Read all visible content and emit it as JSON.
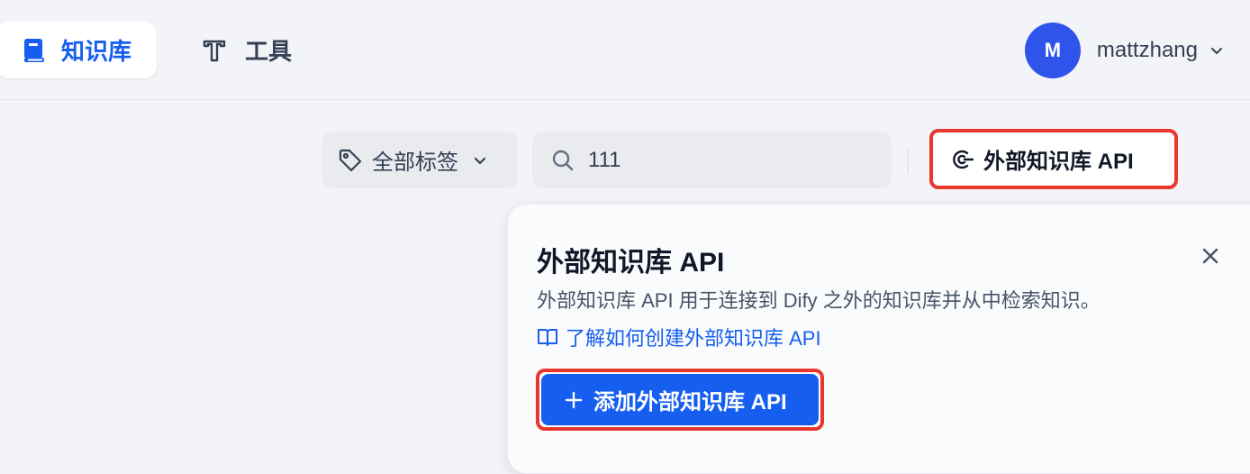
{
  "nav": {
    "tabs": [
      {
        "label": "知识库",
        "icon": "book-icon",
        "active": true
      },
      {
        "label": "工具",
        "icon": "tools-icon",
        "active": false
      }
    ]
  },
  "user": {
    "initial": "M",
    "name": "mattzhang",
    "avatar_color": "#2f54eb"
  },
  "filters": {
    "tag_label": "全部标签",
    "search_value": "111"
  },
  "external_api_button": {
    "label": "外部知识库 API"
  },
  "panel": {
    "title": "外部知识库 API",
    "description": "外部知识库 API 用于连接到 Dify 之外的知识库并从中检索知识。",
    "learn_link": "了解如何创建外部知识库 API",
    "add_button": "添加外部知识库 API"
  },
  "colors": {
    "accent": "#155eef",
    "highlight": "#e7372f"
  }
}
